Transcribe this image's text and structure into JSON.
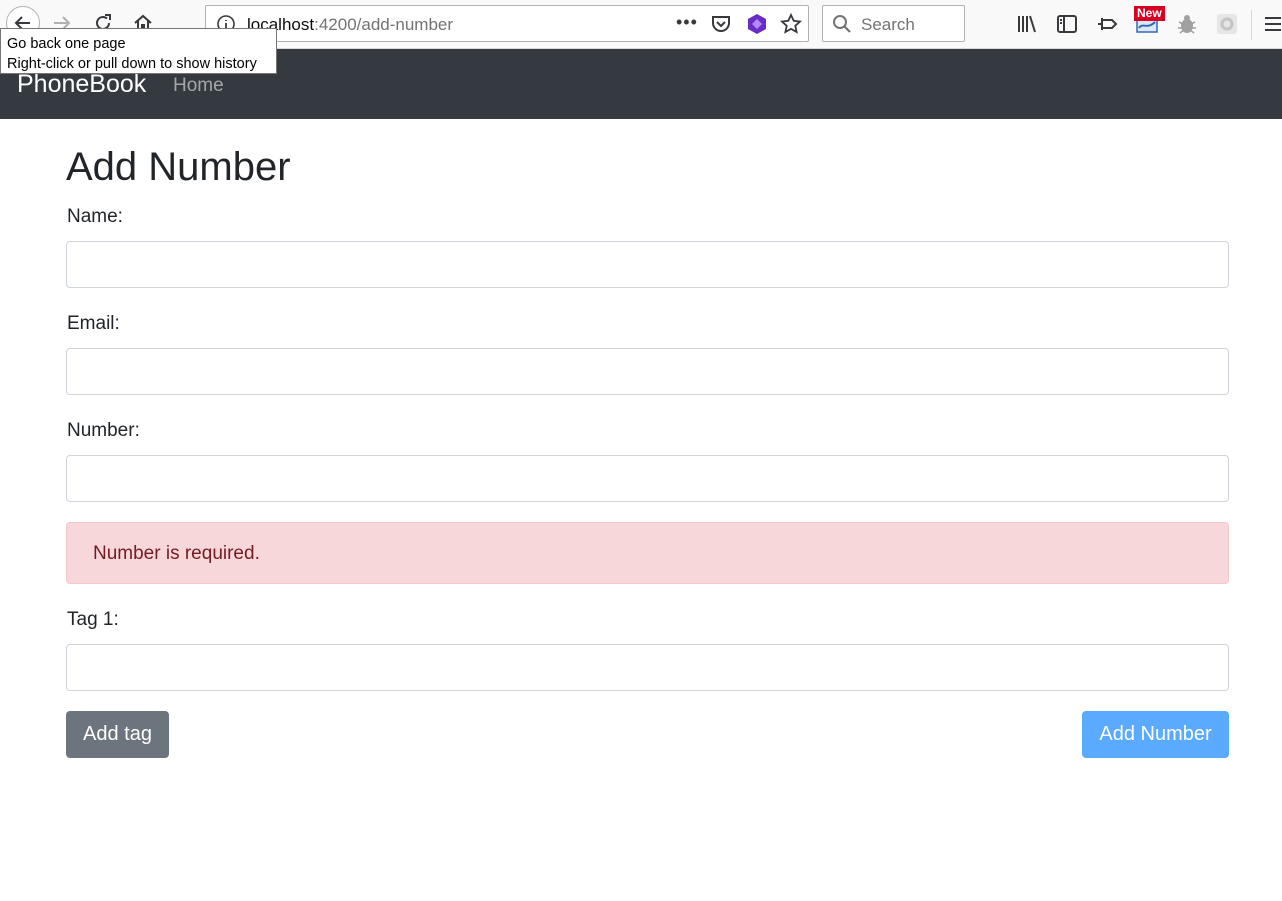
{
  "browser": {
    "url_host": "localhost",
    "url_path": ":4200/add-number",
    "search_placeholder": "Search",
    "new_badge": "New",
    "tooltip": {
      "line1": "Go back one page",
      "line2": "Right-click or pull down to show history"
    },
    "icons": [
      "back-icon",
      "forward-icon",
      "reload-icon",
      "home-icon",
      "info-icon",
      "more-icon",
      "pocket-icon",
      "extension-icon",
      "bookmark-star-icon",
      "search-icon",
      "library-icon",
      "sidebar-icon",
      "pin-icon",
      "extension-new-icon",
      "bug-icon",
      "gear-extension-icon",
      "menu-icon"
    ]
  },
  "navbar": {
    "brand": "PhoneBook",
    "links": [
      {
        "label": "Home"
      }
    ]
  },
  "form": {
    "title": "Add Number",
    "fields": [
      {
        "label": "Name:",
        "value": ""
      },
      {
        "label": "Email:",
        "value": ""
      },
      {
        "label": "Number:",
        "value": ""
      },
      {
        "label": "Tag 1:",
        "value": ""
      }
    ],
    "error": "Number is required.",
    "add_tag_label": "Add tag",
    "add_number_label": "Add Number"
  },
  "colors": {
    "navbar_bg": "#343a40",
    "alert_bg": "#f8d7da",
    "alert_text": "#721c24",
    "secondary_button": "#6c757d",
    "primary_button": "#5aabff"
  }
}
